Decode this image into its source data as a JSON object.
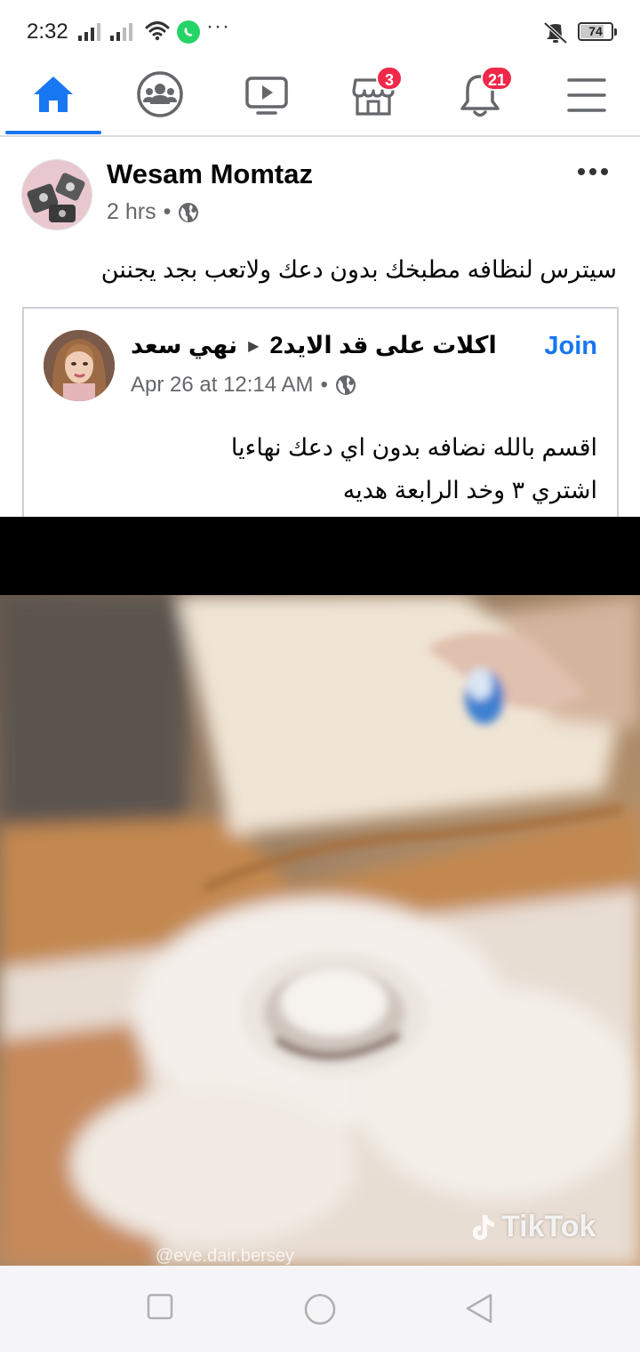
{
  "status_bar": {
    "time": "2:32",
    "more": "···",
    "battery": "74",
    "icons": [
      "signal-icon",
      "signal-icon",
      "wifi-icon",
      "whatsapp-icon",
      "mute-icon",
      "battery-icon"
    ]
  },
  "nav": {
    "items": [
      {
        "name": "home",
        "icon": "home-icon",
        "active": true
      },
      {
        "name": "groups",
        "icon": "groups-icon"
      },
      {
        "name": "watch",
        "icon": "video-icon"
      },
      {
        "name": "marketplace",
        "icon": "marketplace-icon",
        "badge": "3"
      },
      {
        "name": "notifications",
        "icon": "bell-icon",
        "badge": "21"
      },
      {
        "name": "menu",
        "icon": "menu-icon"
      }
    ],
    "accent": "#1877f2",
    "badge_color": "#f02849"
  },
  "post": {
    "author": "Wesam Momtaz",
    "time": "2 hrs",
    "separator": "•",
    "text": "سيترس لنظافه مطبخك بدون دعك ولاتعب بجد يجننن"
  },
  "shared": {
    "user": "نهي سعد",
    "group": "2اكلات على قد الايد",
    "join": "Join",
    "time": "Apr 26 at 12:14 AM",
    "separator": "•",
    "lines": [
      "اقسم بالله نضافه بدون اي دعك نهاءيا",
      "اشتري ٣ وخد الرابعة هديه"
    ]
  },
  "video": {
    "watermark": "TikTok",
    "watermark_user": "@eve.dair.bersey"
  }
}
